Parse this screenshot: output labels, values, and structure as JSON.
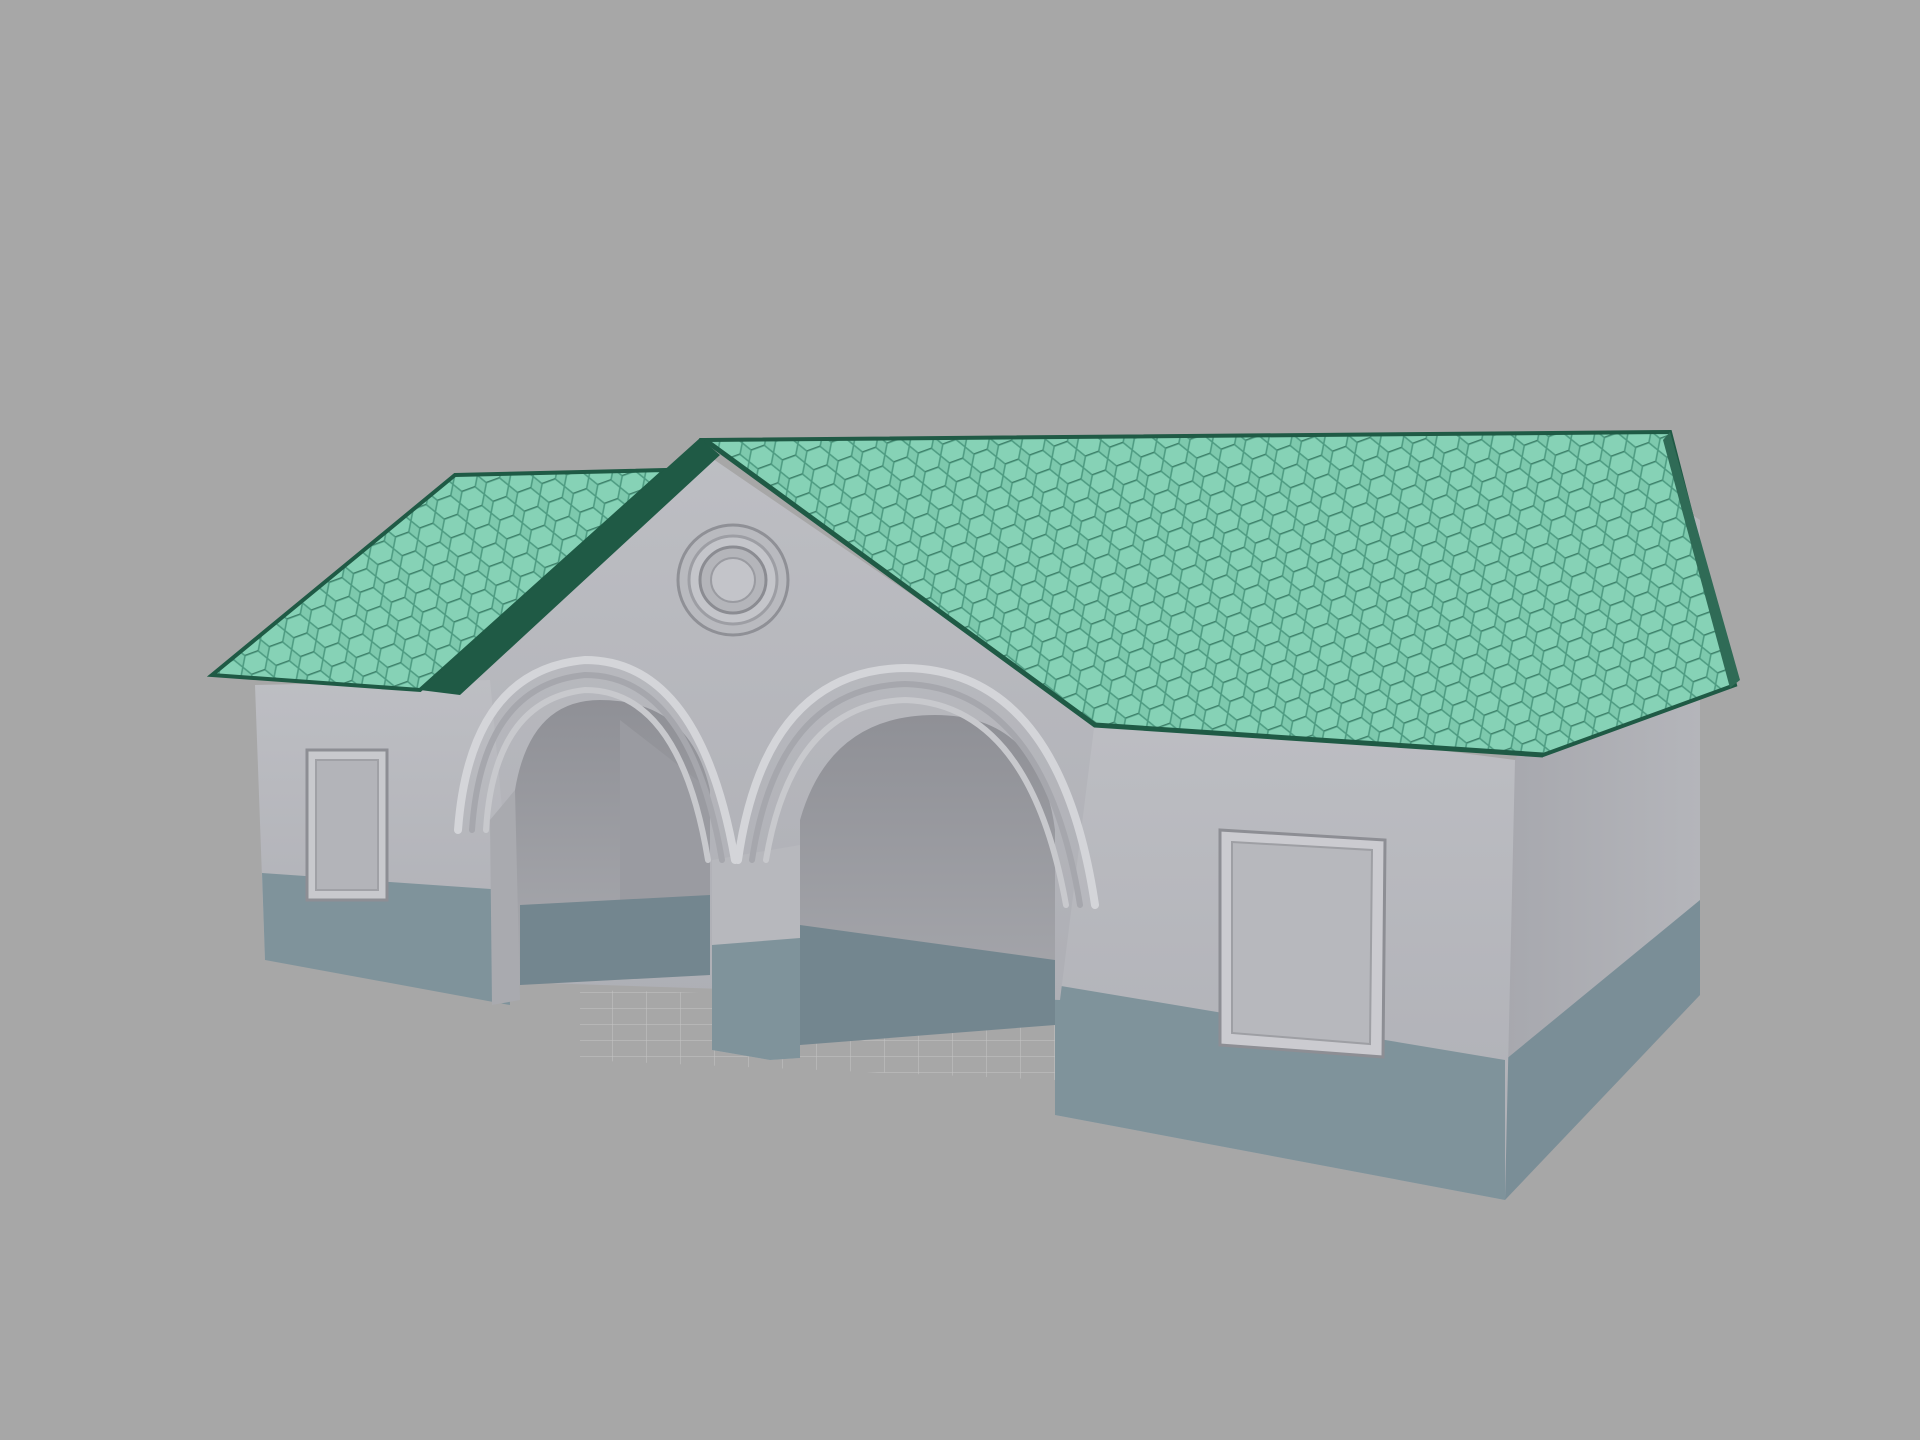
{
  "scene": {
    "subject": "house-model",
    "colors": {
      "background": "#a7a7a7",
      "roof_tile": "#7dc9ad",
      "roof_tile_dark": "#4f9a80",
      "roof_edge": "#1f5a45",
      "wall": "#b5b6bb",
      "wall_shadow": "#9c9da3",
      "wall_side": "#a4a5ab",
      "base_band": "#7f939b",
      "base_band_dark": "#6f838c",
      "floor_grid": "#c6c6c6"
    }
  }
}
